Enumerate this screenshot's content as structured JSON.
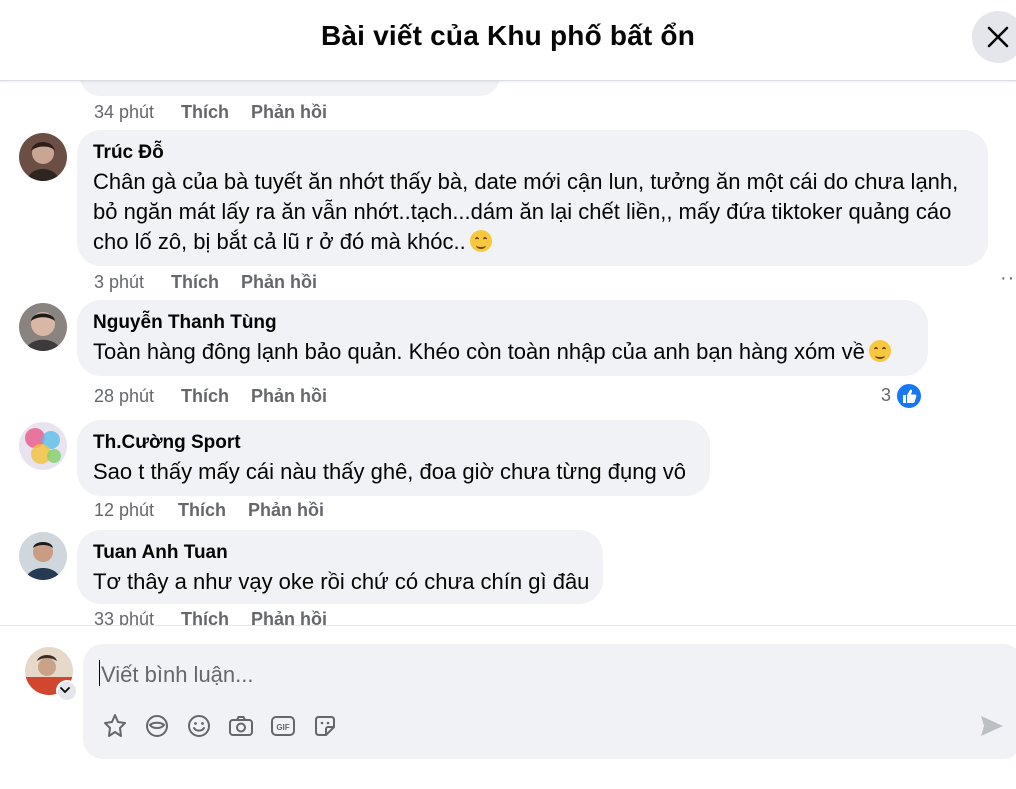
{
  "header": {
    "title": "Bài viết của Khu phố bất ổn",
    "close_icon": "close-icon"
  },
  "prev_comment": {
    "time": "34 phút",
    "like": "Thích",
    "reply": "Phản hồi"
  },
  "comments": [
    {
      "author": "Trúc Đỗ",
      "text": "Chân gà của bà tuyết ăn nhớt thấy bà, date mới cận lun, tưởng ăn một cái do chưa lạnh,\nbỏ ngăn mát lấy ra ăn vẫn nhớt..tạch...dám ăn lại chết liền,, mấy đứa tiktoker quảng cáo\ncho lố zô, bị bắt cả lũ r ở đó mà khóc..",
      "emoji": "relieved-face-emoji",
      "time": "3 phút",
      "like": "Thích",
      "reply": "Phản hồi"
    },
    {
      "author": "Nguyễn Thanh Tùng",
      "text": "Toàn hàng đông lạnh bảo quản. Khéo còn toàn nhập của anh bạn hàng xóm về",
      "emoji": "grinning-sweat-emoji",
      "time": "28 phút",
      "like": "Thích",
      "reply": "Phản hồi",
      "reaction_count": "3"
    },
    {
      "author": "Th.Cường Sport",
      "text": "Sao t thấy mấy cái nàu thấy ghê, đoa giờ chưa từng đụng vô",
      "time": "12 phút",
      "like": "Thích",
      "reply": "Phản hồi"
    },
    {
      "author": "Tuan Anh Tuan",
      "text": "Tơ thây a như vạy oke rồi chứ có chưa chín gì đâu",
      "time": "33 phút",
      "like": "Thích",
      "reply": "Phản hồi"
    }
  ],
  "composer": {
    "placeholder": "Viết bình luận...",
    "tools": [
      "avatar-sticker-icon",
      "mask-sticker-icon",
      "emoji-icon",
      "camera-icon",
      "gif-icon",
      "sticker-icon"
    ],
    "send_icon": "send-icon"
  },
  "colors": {
    "bubble": "#f0f2f5",
    "meta_text": "#65676b",
    "like_blue": "#1877f2"
  }
}
